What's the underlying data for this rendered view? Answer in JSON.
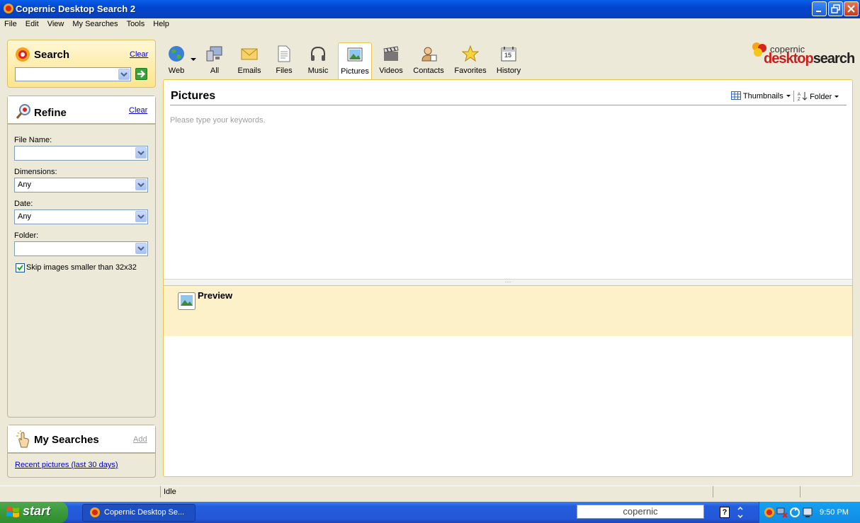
{
  "window": {
    "title": "Copernic Desktop Search 2"
  },
  "menu": [
    "File",
    "Edit",
    "View",
    "My Searches",
    "Tools",
    "Help"
  ],
  "search": {
    "title": "Search",
    "clear": "Clear",
    "value": "",
    "go_icon": "arrow-right-icon"
  },
  "refine": {
    "title": "Refine",
    "clear": "Clear",
    "fields": [
      {
        "label": "File Name:",
        "value": ""
      },
      {
        "label": "Dimensions:",
        "value": "Any"
      },
      {
        "label": "Date:",
        "value": "Any"
      },
      {
        "label": "Folder:",
        "value": ""
      }
    ],
    "skip_checked": true,
    "skip_label": "Skip images smaller than 32x32"
  },
  "my_searches": {
    "title": "My Searches",
    "add": "Add",
    "items": [
      "Recent pictures (last 30 days)"
    ]
  },
  "categories": [
    {
      "label": "Web",
      "icon": "globe-icon"
    },
    {
      "label": "All",
      "icon": "computer-icon"
    },
    {
      "label": "Emails",
      "icon": "envelope-icon"
    },
    {
      "label": "Files",
      "icon": "document-icon"
    },
    {
      "label": "Music",
      "icon": "headphones-icon"
    },
    {
      "label": "Pictures",
      "icon": "picture-icon",
      "selected": true
    },
    {
      "label": "Videos",
      "icon": "clapperboard-icon"
    },
    {
      "label": "Contacts",
      "icon": "contact-icon"
    },
    {
      "label": "Favorites",
      "icon": "star-icon"
    },
    {
      "label": "History",
      "icon": "calendar-icon",
      "day": "15"
    }
  ],
  "logo": {
    "small": "copernic",
    "big_a": "desktop",
    "big_b": "search"
  },
  "main": {
    "title": "Pictures",
    "view_label": "Thumbnails",
    "sort_label": "Folder",
    "hint": "Please type your keywords.",
    "preview_title": "Preview"
  },
  "status": {
    "text": "Idle"
  },
  "taskbar": {
    "start": "start",
    "app_button": "Copernic Desktop Se...",
    "deskbar_text": "copernic",
    "clock": "9:50 PM"
  },
  "colors": {
    "accent": "#E8C74F",
    "link": "#0000CC",
    "title_bar": "#0A5FE8"
  }
}
